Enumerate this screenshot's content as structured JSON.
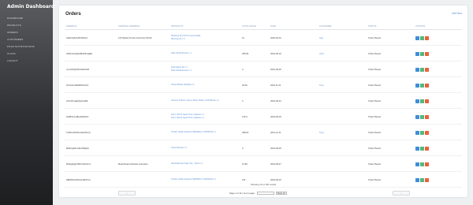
{
  "sidebar": {
    "title": "Admin Dashboard",
    "items": [
      "Dashboard",
      "Products",
      "Orders",
      "Customers",
      "Push Notifications",
      "Clans",
      "Logout"
    ]
  },
  "main": {
    "title": "Orders",
    "add_new": "Add New"
  },
  "table": {
    "headers": [
      "ORDER ID",
      "SHIPPING ADDRESS",
      "PRODUCTS",
      "TOTAL PRICE",
      "DATE",
      "CUSTOMER",
      "STATUS",
      "ACTIONS"
    ],
    "rows": [
      {
        "id": "H0kGhq6zFwfKhbDmz",
        "address": "123 Market St San Francisco 94107",
        "products": [
          "Washing Dry Dri Ka Lama Sedla",
          "Morning Kit x 2"
        ],
        "total": "10",
        "date": "2020-02-03",
        "customer": "Ivan",
        "status": "Order Placed"
      },
      {
        "id": "HN5mrtwQ9uZMSZ3mQEE",
        "address": "",
        "products": [
          "Slice Mode Renew x 1"
        ],
        "total": "255.84",
        "date": "2019-06-19",
        "customer": "John",
        "status": "Order Placed"
      },
      {
        "id": "umcvbDQFShcZtdsr8n8",
        "address": "",
        "products": [
          "Pixel Rebel Kit x 1",
          "Slice Mode Renew x 1"
        ],
        "total": "0",
        "date": "2019-09-05",
        "customer": "",
        "status": "Order Placed"
      },
      {
        "id": "bOsL6sm8HWfHhKQz1",
        "address": "",
        "products": [
          "Grand Whale Sandals x 1"
        ],
        "total": "29.60",
        "date": "2019-11-21",
        "customer": "Tony",
        "status": "Order Placed"
      },
      {
        "id": "LKG4Tpqalp6Qs4yRbk",
        "address": "",
        "products": [
          "Autumn & Moon, Rose, Wish, Peach, Grill Wheat x 2"
        ],
        "total": "0",
        "date": "2019-09-24",
        "customer": "",
        "status": "Order Placed"
      },
      {
        "id": "HH8bhmnqBxsWnEF2J",
        "address": "",
        "products": [
          "Don't Tell Fir Sand Thorn Sahara x 2",
          "Don't Tell Fir Sand Thorn Sahara x 1"
        ],
        "total": "120.5",
        "date": "2019-06-18",
        "customer": "",
        "status": "Order Placed"
      },
      {
        "id": "TNRCuhFkWmVaGt5CrQ",
        "address": "",
        "products": [
          "Timber Grelle Autotech SWINMAI x NORDICA x 1"
        ],
        "total": "398.00",
        "date": "2019-12-11",
        "customer": "Tony",
        "status": "Order Placed"
      },
      {
        "id": "BHdcQa3rLHbLP2Njlpin",
        "address": "",
        "products": [
          "Grand Renew x 1"
        ],
        "total": "0",
        "date": "2019-09-05",
        "customer": "",
        "status": "Order Placed"
      },
      {
        "id": "6fCEg0gqTMFhCJDtoCxz",
        "address": "Metal Road Charlotte CameGlo",
        "products": [
          "Sand Element Tape Tan - Stock x 1"
        ],
        "total": "12.89",
        "date": "2019-08-27",
        "customer": "",
        "status": "Order Placed"
      },
      {
        "id": "DjBN6hUzMrHUmEkTrFa",
        "address": "",
        "products": [
          "Timber Grelle Autotech SWINMAI x NORDICA x 1"
        ],
        "total": "115",
        "date": "2019-09-16",
        "customer": "",
        "status": "Order Placed"
      }
    ]
  },
  "pagination": {
    "summary": "Showing 10 of 106 results",
    "prev": "‹",
    "next": "›",
    "page_label": "Page 1 of 11 | Go to page:",
    "page_value": "",
    "show_select": "Show 10"
  }
}
